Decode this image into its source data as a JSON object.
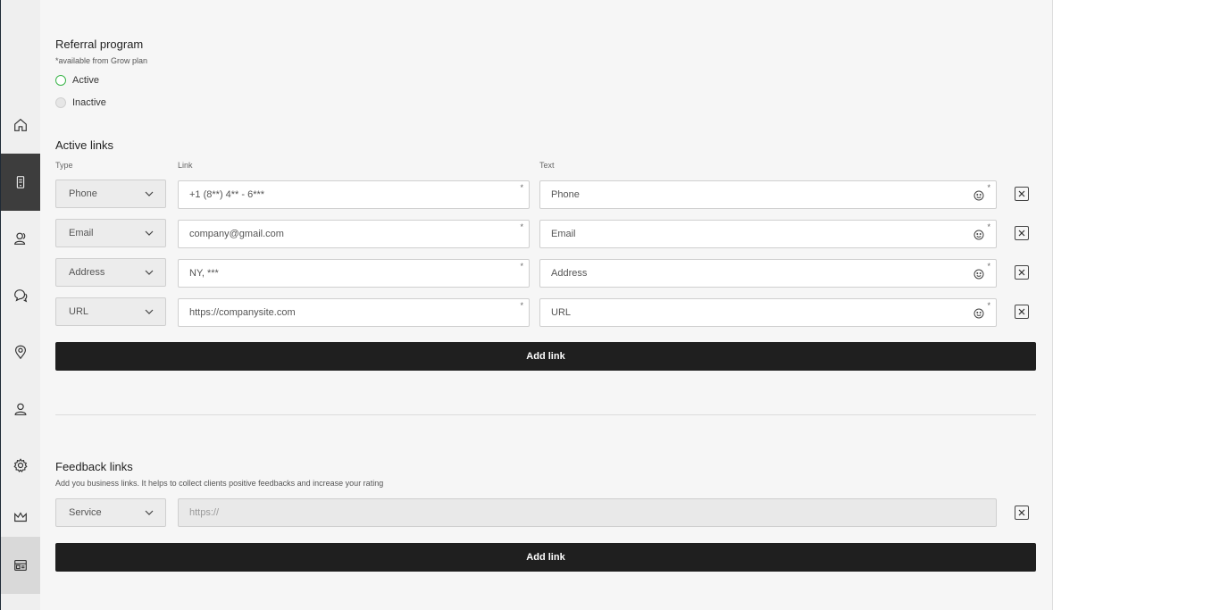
{
  "sidebar": {
    "items": [
      {
        "icon": "home-icon"
      },
      {
        "icon": "device-icon"
      },
      {
        "icon": "users-icon"
      },
      {
        "icon": "chat-icon"
      },
      {
        "icon": "location-pin-icon"
      },
      {
        "icon": "user-icon"
      },
      {
        "icon": "gear-icon"
      },
      {
        "icon": "crown-icon"
      },
      {
        "icon": "store-icon"
      }
    ]
  },
  "referral": {
    "title": "Referral program",
    "note": "*available from Grow plan",
    "options": [
      {
        "label": "Active",
        "selected": true
      },
      {
        "label": "Inactive",
        "selected": false
      }
    ]
  },
  "active_links": {
    "title": "Active links",
    "col_type": "Type",
    "col_link": "Link",
    "col_text": "Text",
    "rows": [
      {
        "type": "Phone",
        "link": "+1 (8**) 4** - 6***",
        "text": "Phone"
      },
      {
        "type": "Email",
        "link": "company@gmail.com",
        "text": "Email"
      },
      {
        "type": "Address",
        "link": "NY, ***",
        "text": "Address"
      },
      {
        "type": "URL",
        "link": "https://companysite.com",
        "text": "URL"
      }
    ],
    "required_mark": "*",
    "add_label": "Add link"
  },
  "feedback": {
    "title": "Feedback links",
    "description": "Add you business links. It helps to collect clients positive feedbacks and increase your rating",
    "type": "Service",
    "placeholder": "https://",
    "add_label": "Add link"
  },
  "colors": {
    "accent_green": "#3bb54a",
    "button_dark": "#1f1f1f"
  }
}
